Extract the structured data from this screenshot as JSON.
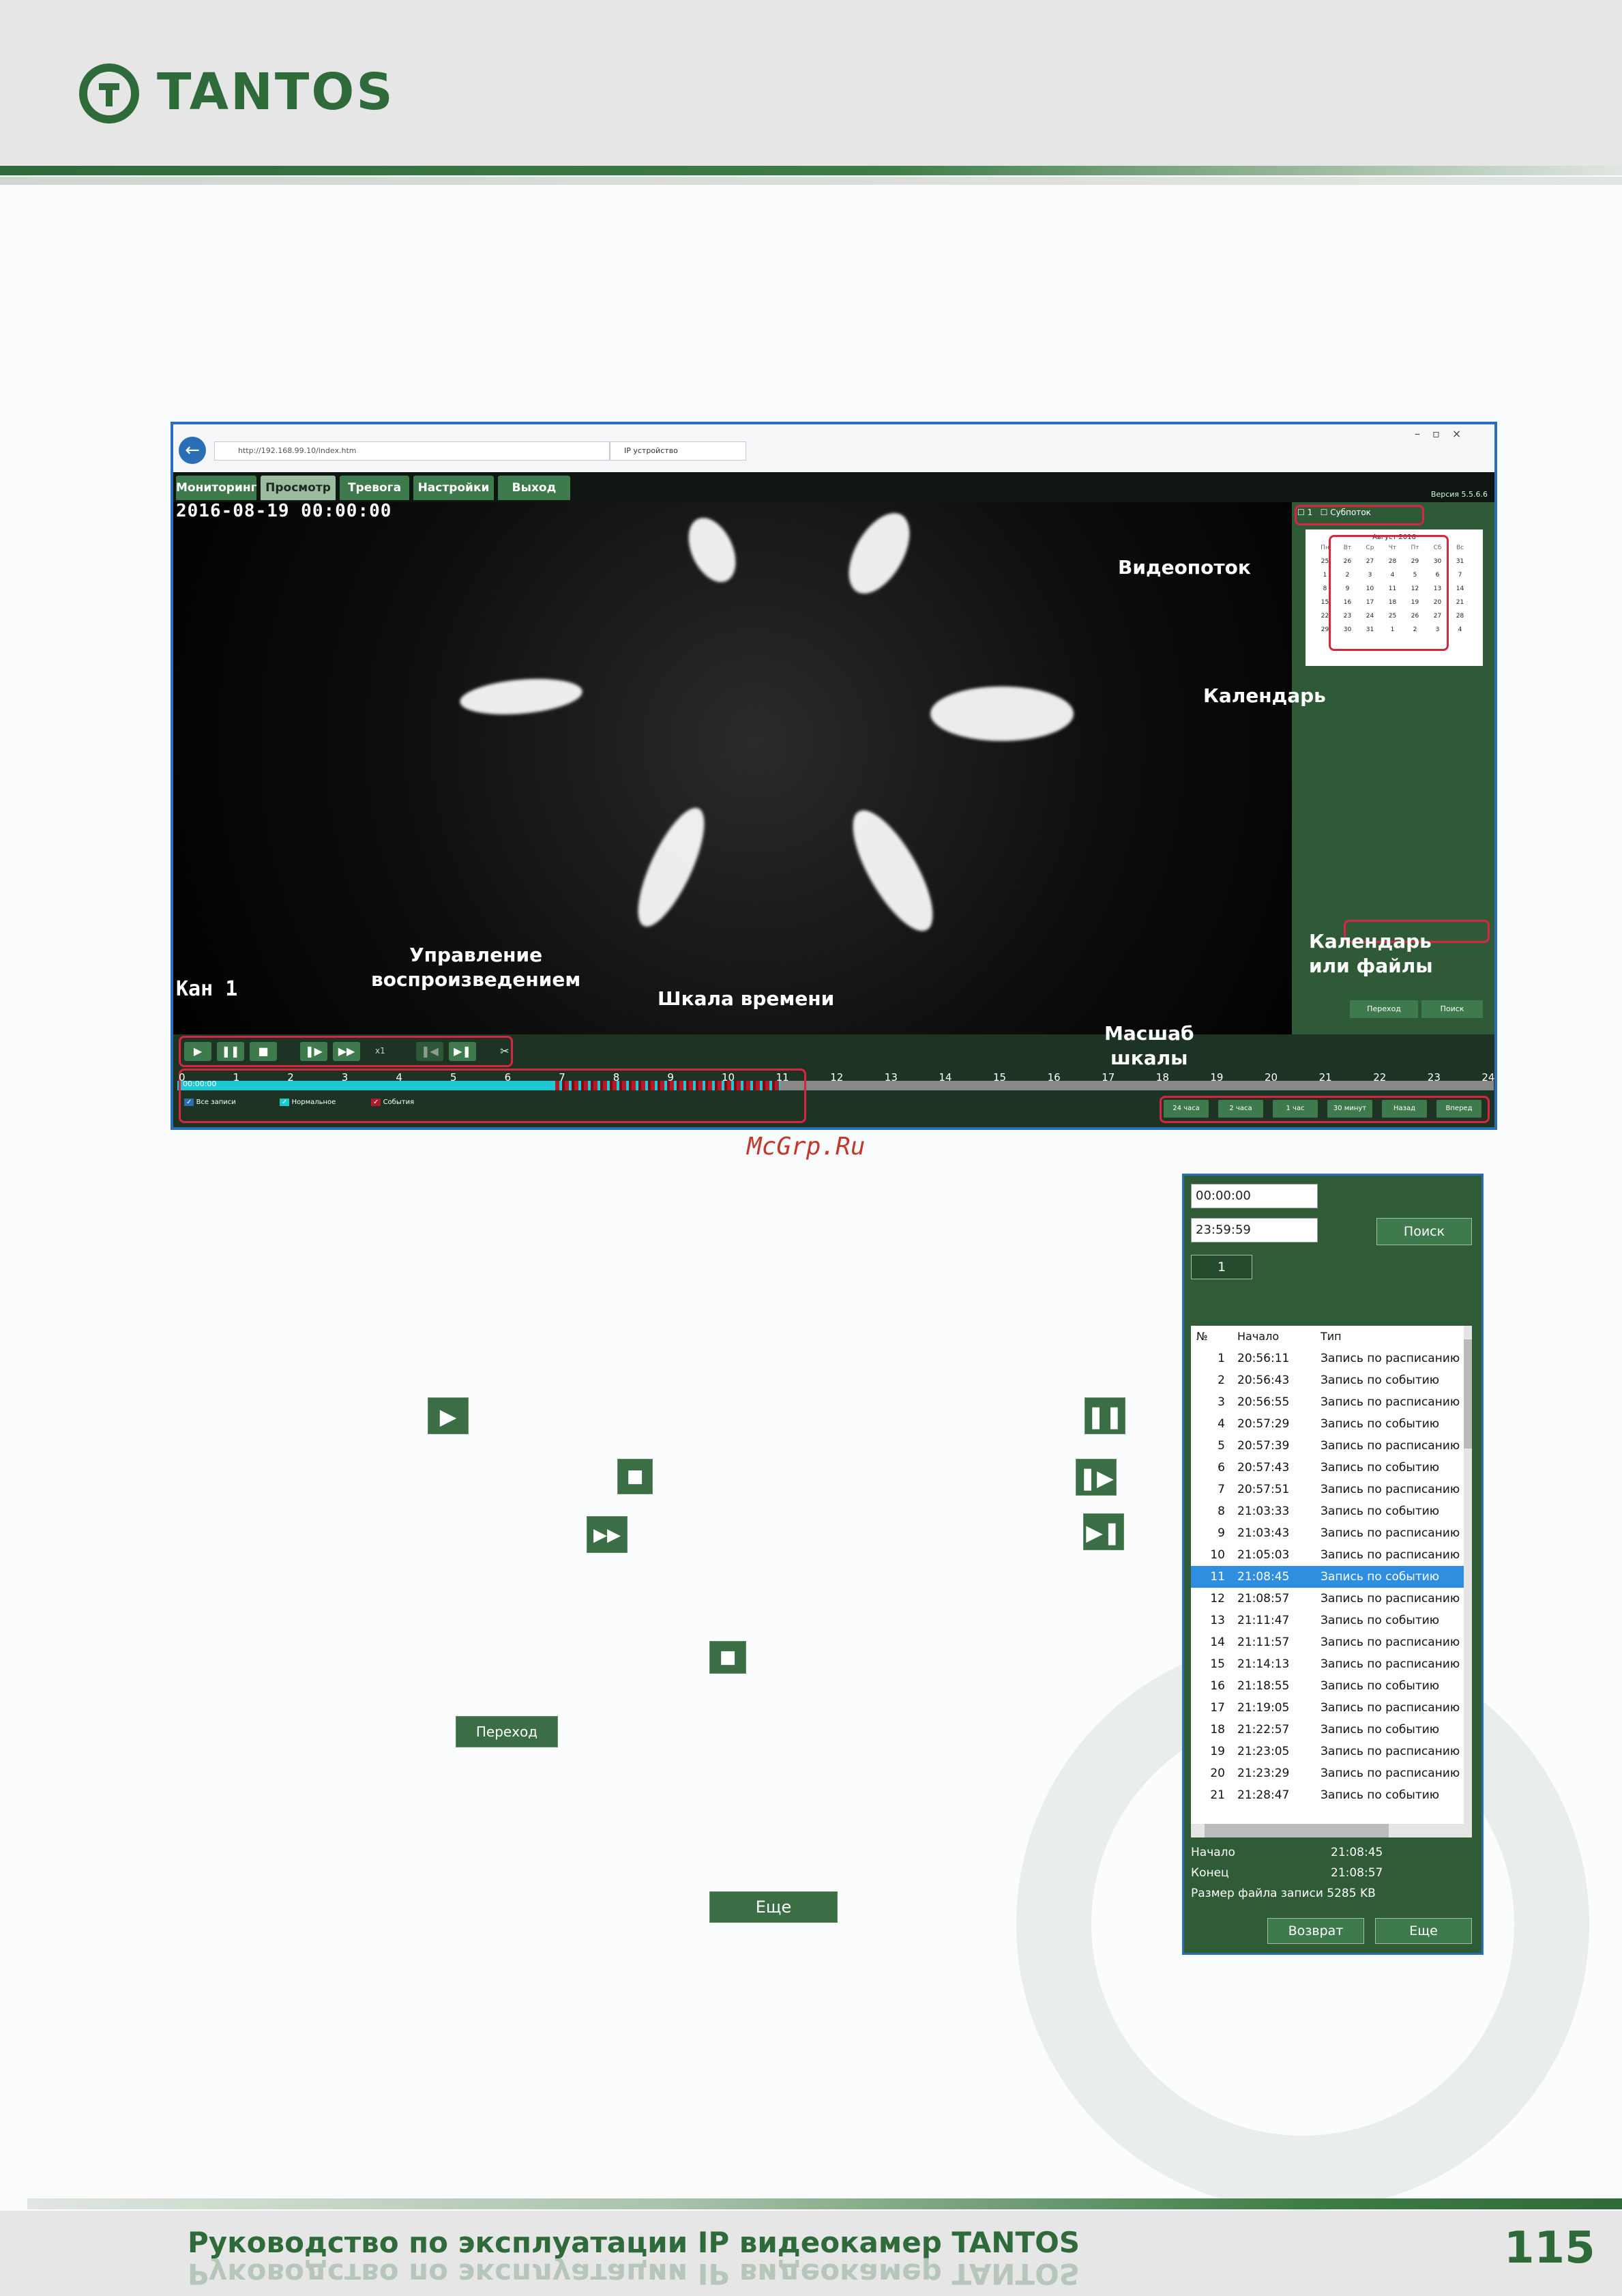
{
  "brand": {
    "name": "TANTOS"
  },
  "screenshot": {
    "browser": {
      "address": "http://192.168.99.10/index.htm",
      "tab": "IP устройство"
    },
    "menu": [
      "Мониторинг",
      "Просмотр",
      "Тревога",
      "Настройки",
      "Выход"
    ],
    "version": "Версия 5.5.6.6",
    "osd_datetime": "2016-08-19  00:00:00",
    "osd_channel": "Кан 1",
    "stream": {
      "ch": "1",
      "substream": "Субпоток"
    },
    "calendar": {
      "month": "Август 2016",
      "weekdays": [
        "Пн",
        "Вт",
        "Ср",
        "Чт",
        "Пт",
        "Сб",
        "Вс"
      ],
      "rows": [
        [
          "25",
          "26",
          "27",
          "28",
          "29",
          "30",
          "31"
        ],
        [
          "1",
          "2",
          "3",
          "4",
          "5",
          "6",
          "7"
        ],
        [
          "8",
          "9",
          "10",
          "11",
          "12",
          "13",
          "14"
        ],
        [
          "15",
          "16",
          "17",
          "18",
          "19",
          "20",
          "21"
        ],
        [
          "22",
          "23",
          "24",
          "25",
          "26",
          "27",
          "28"
        ],
        [
          "29",
          "30",
          "31",
          "1",
          "2",
          "3",
          "4"
        ]
      ]
    },
    "panel_buttons": [
      "Переход",
      "Поиск"
    ],
    "annotations": {
      "stream": "Видеопоток",
      "calendar": "Календарь",
      "cal_or_files": "Календарь\nили файлы",
      "playback": "Управление\nвоспроизведением",
      "timescale": "Шкала времени",
      "zoom": "Масшаб\nшкалы"
    },
    "speed": "x1",
    "timeline_start": "00:00:00",
    "ticks": [
      "0",
      "1",
      "2",
      "3",
      "4",
      "5",
      "6",
      "7",
      "8",
      "9",
      "10",
      "11",
      "12",
      "13",
      "14",
      "15",
      "16",
      "17",
      "18",
      "19",
      "20",
      "21",
      "22",
      "23",
      "24"
    ],
    "legend": [
      "Все записи",
      "Нормальное",
      "События"
    ],
    "scale_buttons": [
      "24 часа",
      "2 часа",
      "1 час",
      "30 минут",
      "Назад",
      "Вперед"
    ]
  },
  "watermark": "McGrp.Ru",
  "file_panel": {
    "time_from": "00:00:00",
    "time_to": "23:59:59",
    "search_button": "Поиск",
    "page": "1",
    "headers": [
      "№",
      "Начало",
      "Тип"
    ],
    "rows": [
      [
        "1",
        "20:56:11",
        "Запись по расписанию"
      ],
      [
        "2",
        "20:56:43",
        "Запись по событию"
      ],
      [
        "3",
        "20:56:55",
        "Запись по расписанию"
      ],
      [
        "4",
        "20:57:29",
        "Запись по событию"
      ],
      [
        "5",
        "20:57:39",
        "Запись по расписанию"
      ],
      [
        "6",
        "20:57:43",
        "Запись по событию"
      ],
      [
        "7",
        "20:57:51",
        "Запись по расписанию"
      ],
      [
        "8",
        "21:03:33",
        "Запись по событию"
      ],
      [
        "9",
        "21:03:43",
        "Запись по расписанию"
      ],
      [
        "10",
        "21:05:03",
        "Запись по расписанию"
      ],
      [
        "11",
        "21:08:45",
        "Запись по событию"
      ],
      [
        "12",
        "21:08:57",
        "Запись по расписанию"
      ],
      [
        "13",
        "21:11:47",
        "Запись по событию"
      ],
      [
        "14",
        "21:11:57",
        "Запись по расписанию"
      ],
      [
        "15",
        "21:14:13",
        "Запись по расписанию"
      ],
      [
        "16",
        "21:18:55",
        "Запись по событию"
      ],
      [
        "17",
        "21:19:05",
        "Запись по расписанию"
      ],
      [
        "18",
        "21:22:57",
        "Запись по событию"
      ],
      [
        "19",
        "21:23:05",
        "Запись по расписанию"
      ],
      [
        "20",
        "21:23:29",
        "Запись по расписанию"
      ],
      [
        "21",
        "21:28:47",
        "Запись по событию"
      ]
    ],
    "selected_row": 10,
    "start_label": "Начало",
    "start_value": "21:08:45",
    "end_label": "Конец",
    "end_value": "21:08:57",
    "size_label": "Размер файла записи",
    "size_value": "5285 KB",
    "return_button": "Возврат",
    "more_button": "Еще"
  },
  "body_buttons": {
    "goto": "Переход",
    "more": "Еще"
  },
  "footer": {
    "title": "Руководство по эксплуатации IP видеокамер TANTOS",
    "page": "115"
  }
}
